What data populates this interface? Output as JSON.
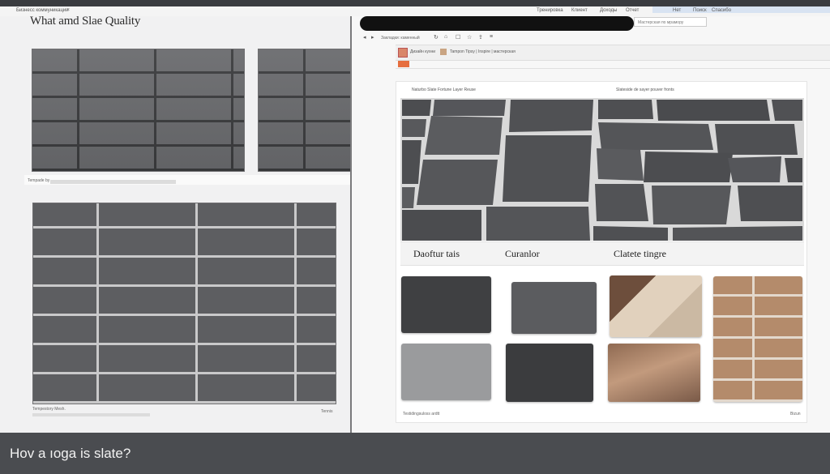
{
  "browser": {
    "tab_title": "Бизнесс коммуникации",
    "tab_close": "×",
    "menu_items": [
      "Тренировка",
      "Клиент",
      "Доходы",
      "Отчет",
      "Нет",
      "Поиск",
      "Спасибо"
    ],
    "address_text": "Мастерская по мрамору"
  },
  "left_page": {
    "title": "What amd Slae Quality",
    "caption_top": "Tempade by",
    "footer_left": "Tempestory Mesh.",
    "footer_right": "Tennis"
  },
  "right_page": {
    "toolbar_icons": [
      "back-icon",
      "forward-icon",
      "reload-icon",
      "home-icon",
      "bookmark-icon",
      "star-icon",
      "share-icon",
      "menu-icon"
    ],
    "toolbar_text": "Закладки: каменный",
    "tab_label": "Дизайн кухни",
    "header_label": "Tampon Tipsy | Inspire  |  мастерская",
    "section_caption_left": "Naturbo Slate Fortune Layer Reuse",
    "section_caption_right": "Slateside de sayer pouver fronts",
    "sample_labels": [
      "Daoftur tais",
      "Curanlor",
      "Clatete tingre"
    ],
    "footer_left": "Testidingsuloss ardtt",
    "footer_right": "Bizun"
  },
  "bottom_banner": {
    "text": "Hov a ıoga is slate?"
  },
  "colors": {
    "slate_dark": "#5d5e61",
    "slate_mid": "#6a6b6e",
    "banner_bg": "#4a4c50"
  }
}
